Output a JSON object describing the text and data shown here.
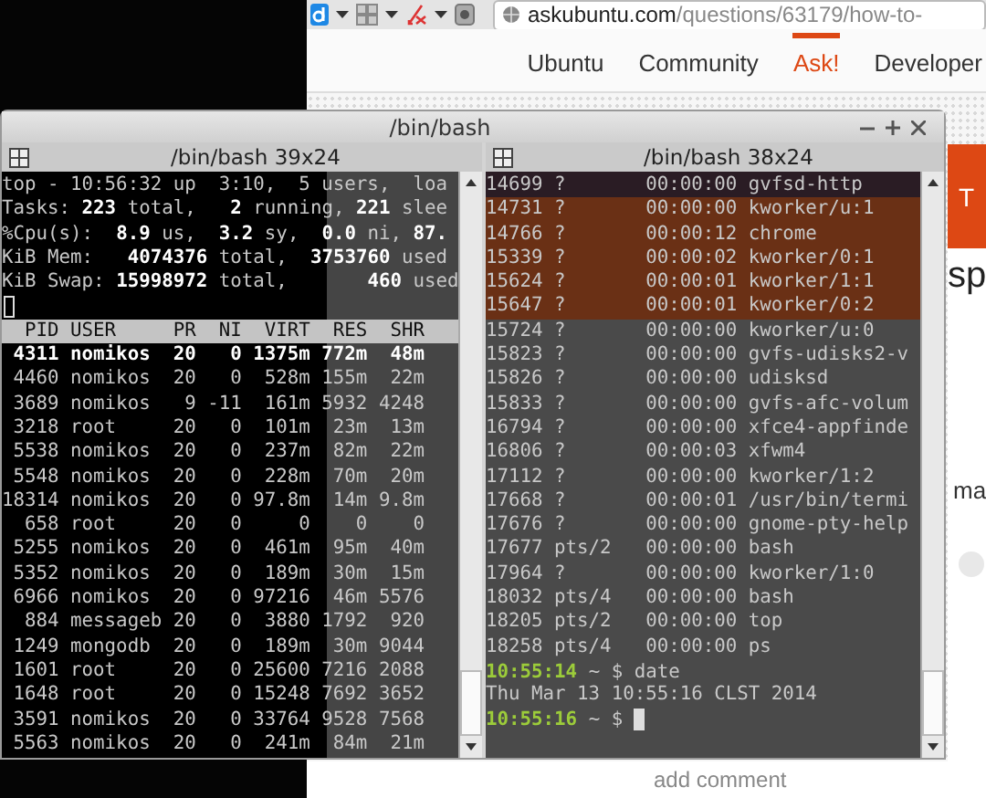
{
  "browser": {
    "url": {
      "domain": "askubuntu.com",
      "path": "/questions/63179/how-to-"
    },
    "nav": [
      {
        "label": "Ubuntu",
        "selected": false
      },
      {
        "label": "Community",
        "selected": false
      },
      {
        "label": "Ask!",
        "selected": true
      },
      {
        "label": "Developer",
        "selected": false
      }
    ],
    "page": {
      "banner_fragment": "T",
      "heading_fragment": "sp",
      "text_fragment": "ma",
      "link": "add comment"
    }
  },
  "terminal": {
    "title": "/bin/bash",
    "panes": [
      {
        "title": "/bin/bash 39x24",
        "lines": [
          {
            "kind": "text",
            "text": "top - 10:56:32 up  3:10,  5 users,  loa"
          },
          {
            "kind": "text",
            "text": "Tasks: **223** total,   **2** running, **221** slee"
          },
          {
            "kind": "text",
            "text": "%Cpu(s):  **8.9** us,  **3.2** sy,  **0.0** ni, **87.**"
          },
          {
            "kind": "text",
            "text": "KiB Mem:   **4074376** total,  **3753760** used"
          },
          {
            "kind": "text",
            "text": "KiB Swap: **15998972** total,       **460** used"
          },
          {
            "kind": "cursor"
          },
          {
            "kind": "header",
            "text": "  PID USER     PR  NI  VIRT  RES  SHR"
          },
          {
            "kind": "bold",
            "text": " 4311 nomikos  20   0 1375m 772m  48m"
          },
          {
            "kind": "row",
            "text": " 4460 nomikos  20   0  528m 155m  22m"
          },
          {
            "kind": "row",
            "text": " 3689 nomikos   9 -11  161m 5932 4248"
          },
          {
            "kind": "row",
            "text": " 3218 root     20   0  101m  23m  13m"
          },
          {
            "kind": "row",
            "text": " 5538 nomikos  20   0  237m  82m  22m"
          },
          {
            "kind": "row",
            "text": " 5548 nomikos  20   0  228m  70m  20m"
          },
          {
            "kind": "row",
            "text": "18314 nomikos  20   0 97.8m  14m 9.8m"
          },
          {
            "kind": "row",
            "text": "  658 root     20   0     0    0    0"
          },
          {
            "kind": "row",
            "text": " 5255 nomikos  20   0  461m  95m  40m"
          },
          {
            "kind": "row",
            "text": " 5352 nomikos  20   0  189m  30m  15m"
          },
          {
            "kind": "row",
            "text": " 6966 nomikos  20   0 97216  46m 5576"
          },
          {
            "kind": "row",
            "text": "  884 messageb 20   0  3880 1792  920"
          },
          {
            "kind": "row",
            "text": " 1249 mongodb  20   0  189m  30m 9044"
          },
          {
            "kind": "row",
            "text": " 1601 root     20   0 25600 7216 2088"
          },
          {
            "kind": "row",
            "text": " 1648 root     20   0 15248 7692 3652"
          },
          {
            "kind": "row",
            "text": " 3591 nomikos  20   0 33764 9528 7568"
          },
          {
            "kind": "row",
            "text": " 5563 nomikos  20   0  241m  84m  21m"
          }
        ]
      },
      {
        "title": "/bin/bash 38x24",
        "lines": [
          {
            "kind": "row",
            "text": "14699 ?       00:00:00 gvfsd-http"
          },
          {
            "kind": "row",
            "text": "14731 ?       00:00:00 kworker/u:1"
          },
          {
            "kind": "row",
            "text": "14766 ?       00:00:12 chrome"
          },
          {
            "kind": "row",
            "text": "15339 ?       00:00:02 kworker/0:1"
          },
          {
            "kind": "row",
            "text": "15624 ?       00:00:01 kworker/1:1"
          },
          {
            "kind": "row",
            "text": "15647 ?       00:00:01 kworker/0:2"
          },
          {
            "kind": "row",
            "text": "15724 ?       00:00:00 kworker/u:0"
          },
          {
            "kind": "row",
            "text": "15823 ?       00:00:00 gvfs-udisks2-v"
          },
          {
            "kind": "row",
            "text": "15826 ?       00:00:00 udisksd"
          },
          {
            "kind": "row",
            "text": "15833 ?       00:00:00 gvfs-afc-volum"
          },
          {
            "kind": "row",
            "text": "16794 ?       00:00:00 xfce4-appfinde"
          },
          {
            "kind": "row",
            "text": "16806 ?       00:00:03 xfwm4"
          },
          {
            "kind": "row",
            "text": "17112 ?       00:00:00 kworker/1:2"
          },
          {
            "kind": "row",
            "text": "17668 ?       00:00:01 /usr/bin/termi"
          },
          {
            "kind": "row",
            "text": "17676 ?       00:00:00 gnome-pty-help"
          },
          {
            "kind": "row",
            "text": "17677 pts/2   00:00:00 bash"
          },
          {
            "kind": "row",
            "text": "17964 ?       00:00:00 kworker/1:0"
          },
          {
            "kind": "row",
            "text": "18032 pts/4   00:00:00 bash"
          },
          {
            "kind": "row",
            "text": "18205 pts/2   00:00:00 top"
          },
          {
            "kind": "row",
            "text": "18258 pts/4   00:00:00 ps"
          },
          {
            "kind": "prompt",
            "time": "10:55:14",
            "command": "~ $ date",
            "cursor": false
          },
          {
            "kind": "row",
            "text": "Thu Mar 13 10:55:16 CLST 2014"
          },
          {
            "kind": "prompt",
            "time": "10:55:16",
            "command": "~ $",
            "cursor": true
          }
        ]
      }
    ]
  }
}
